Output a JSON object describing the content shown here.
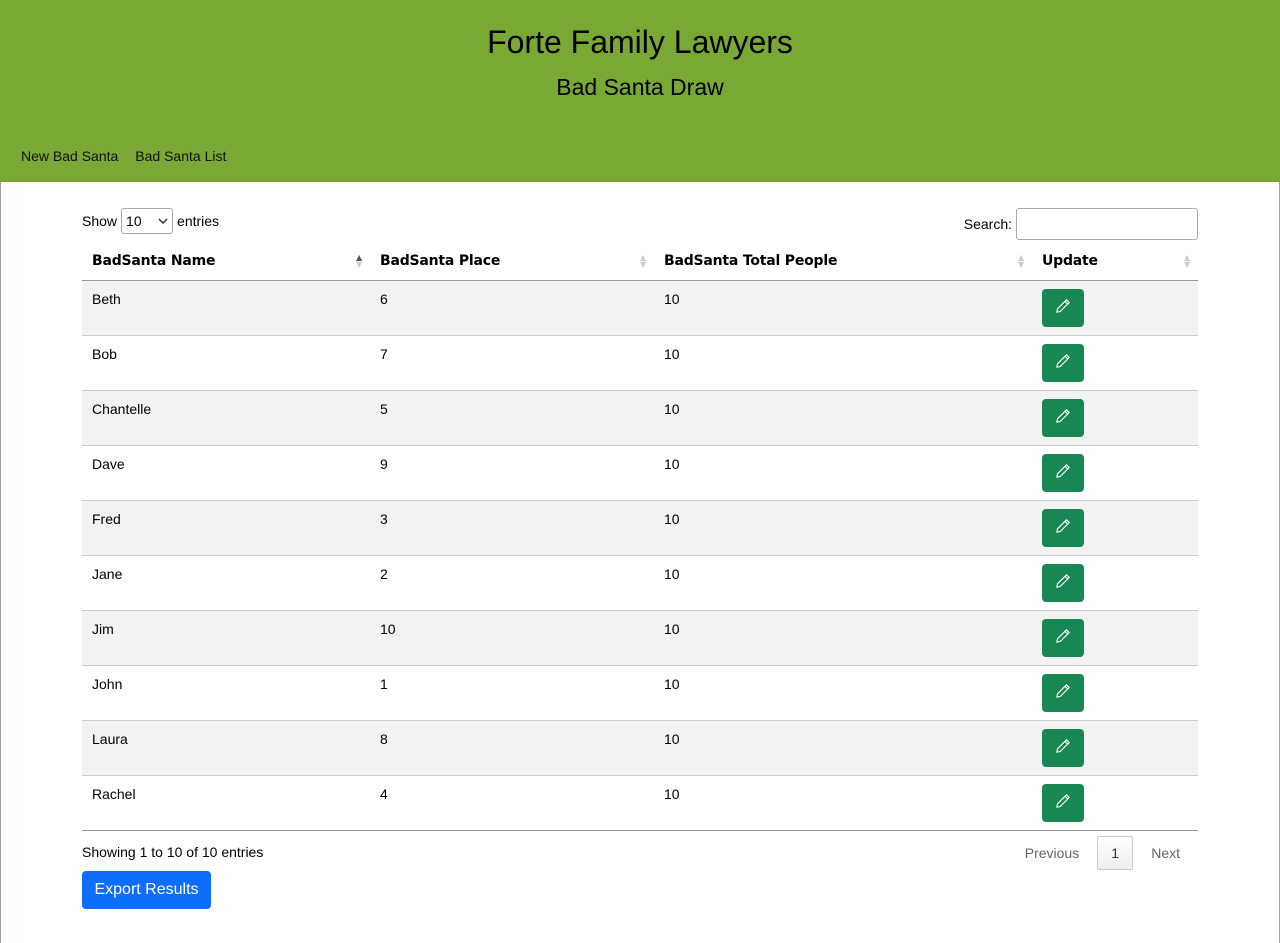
{
  "header": {
    "title": "Forte Family Lawyers",
    "subtitle": "Bad Santa Draw",
    "nav": [
      "New Bad Santa",
      "Bad Santa List"
    ],
    "background_color": "#7aa834"
  },
  "table_controls": {
    "show_label": "Show",
    "entries_label": "entries",
    "page_length": "10",
    "search_label": "Search:",
    "search_value": ""
  },
  "table": {
    "columns": [
      "BadSanta Name",
      "BadSanta Place",
      "BadSanta Total People",
      "Update"
    ],
    "sorted_column": "BadSanta Name",
    "sort_direction": "ascending",
    "rows": [
      {
        "name": "Beth",
        "place": "6",
        "total": "10"
      },
      {
        "name": "Bob",
        "place": "7",
        "total": "10"
      },
      {
        "name": "Chantelle",
        "place": "5",
        "total": "10"
      },
      {
        "name": "Dave",
        "place": "9",
        "total": "10"
      },
      {
        "name": "Fred",
        "place": "3",
        "total": "10"
      },
      {
        "name": "Jane",
        "place": "2",
        "total": "10"
      },
      {
        "name": "Jim",
        "place": "10",
        "total": "10"
      },
      {
        "name": "John",
        "place": "1",
        "total": "10"
      },
      {
        "name": "Laura",
        "place": "8",
        "total": "10"
      },
      {
        "name": "Rachel",
        "place": "4",
        "total": "10"
      }
    ],
    "row_action_icon": "pencil-icon",
    "row_action_color": "#198754"
  },
  "footer": {
    "info": "Showing 1 to 10 of 10 entries",
    "previous": "Previous",
    "current_page": "1",
    "next": "Next",
    "export_label": "Export Results",
    "export_color": "#0d6efd"
  }
}
